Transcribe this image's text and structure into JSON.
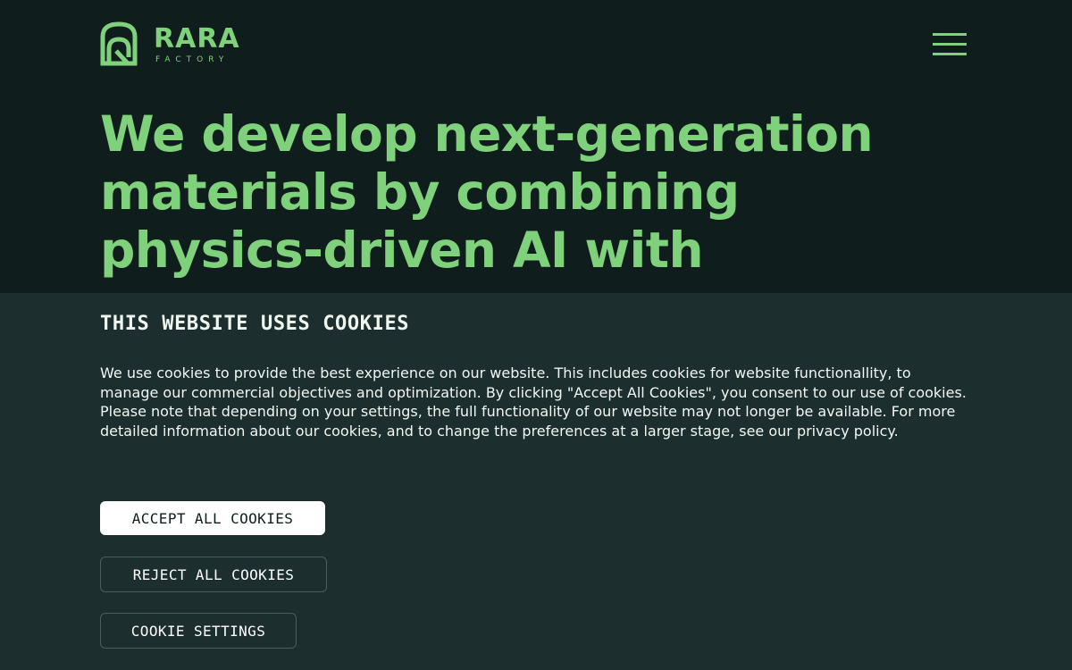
{
  "colors": {
    "background": "#0f1d1c",
    "accent": "#7fd17b",
    "banner_background": "#1c2e2e",
    "banner_text": "#f1f7f2",
    "accept_button_background": "#ffffff",
    "outline_border": "#4b5d5c"
  },
  "header": {
    "logo": {
      "icon": "rara-factory-logo-icon",
      "wordmark": "RARA",
      "subtext": "FACTORY"
    },
    "menu": {
      "icon": "hamburger-menu-icon"
    }
  },
  "hero": {
    "headline": "We develop next-generation materials by combining physics-driven AI with"
  },
  "cookie_banner": {
    "title": "THIS WEBSITE USES COOKIES",
    "paragraph_1": "We use cookies to provide the best experience on our website. This includes cookies for website functionallity, to manage our commercial objectives and optimization. By clicking \"Accept All Cookies\", you consent to our use of cookies.",
    "paragraph_2": "Please note that depending on your settings, the full functionality of our website may not longer be available.  For more detailed information about our cookies, and to  change the preferences at a larger stage, see our privacy policy.",
    "buttons": {
      "accept": "ACCEPT ALL COOKIES",
      "reject": "REJECT ALL COOKIES",
      "settings": "COOKIE SETTINGS"
    }
  }
}
